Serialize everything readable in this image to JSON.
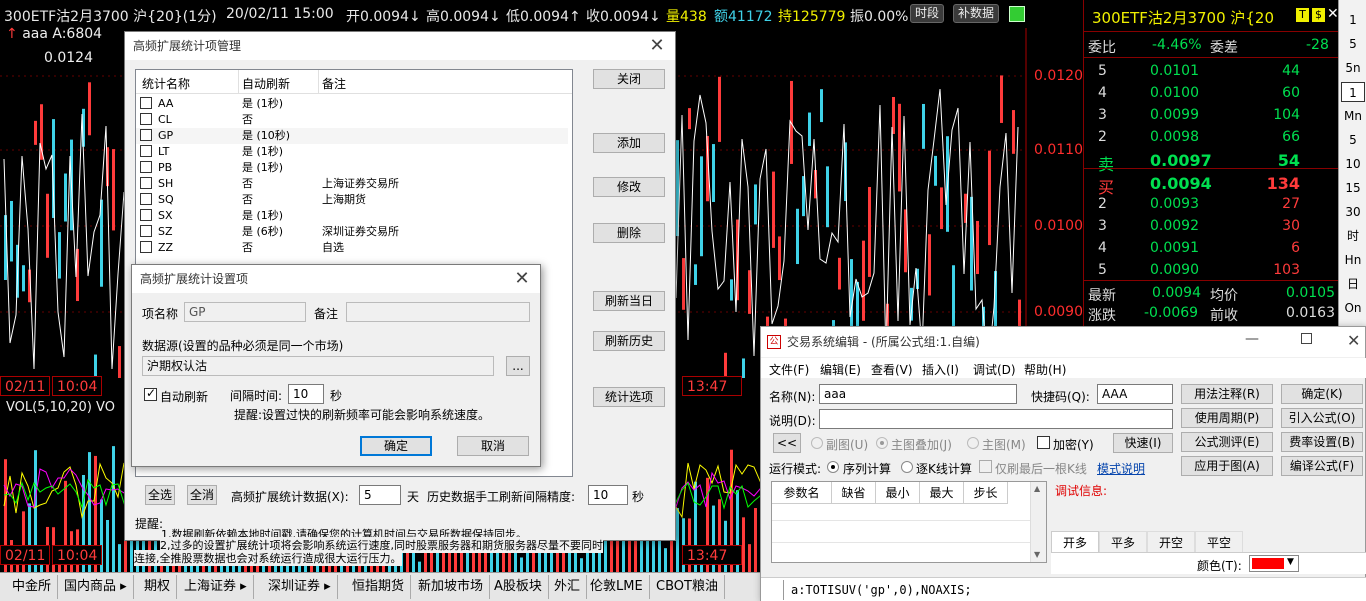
{
  "chart_header": {
    "title": "300ETF沽2月3700 沪{20}(1分)",
    "date_time": "20/02/11 15:00",
    "open": "开0.0094↓",
    "high": "高0.0094↓",
    "low": "低0.0094↑",
    "close": "收0.0094↓",
    "volume": "量438",
    "amount": "额41172",
    "hold": "持125779",
    "amplitude": "振0.00%",
    "btn_time_segment": "时段",
    "btn_fill_data": "补数据",
    "sub_title": "aaa  A:6804",
    "max_label": "0.0124"
  },
  "price_axis": [
    "0.0120",
    "0.0110",
    "0.0100",
    "0.0090"
  ],
  "date_boxes": {
    "top_left_a": "02/11",
    "top_left_b": "10:04",
    "top_right_a": "13:47",
    "bottom_left_a": "02/11",
    "bottom_left_b": "10:04",
    "bottom_right_a": "13:47"
  },
  "vol_label": "VOL(5,10,20) VO",
  "quote_panel": {
    "title": "300ETF沽2月3700 沪{20",
    "badge_t": "T",
    "badge_s": "$",
    "wei_bi_label": "委比",
    "wei_bi_value": "-4.46%",
    "wei_cha_label": "委差",
    "wei_cha_value": "-28",
    "sell": [
      {
        "level": "5",
        "price": "0.0101",
        "vol": "44"
      },
      {
        "level": "4",
        "price": "0.0100",
        "vol": "60"
      },
      {
        "level": "3",
        "price": "0.0099",
        "vol": "104"
      },
      {
        "level": "2",
        "price": "0.0098",
        "vol": "66"
      },
      {
        "level": "卖",
        "price": "0.0097",
        "vol": "54"
      }
    ],
    "buy": [
      {
        "level": "买",
        "price": "0.0094",
        "vol": "134"
      },
      {
        "level": "2",
        "price": "0.0093",
        "vol": "27"
      },
      {
        "level": "3",
        "price": "0.0092",
        "vol": "30"
      },
      {
        "level": "4",
        "price": "0.0091",
        "vol": "6"
      },
      {
        "level": "5",
        "price": "0.0090",
        "vol": "103"
      }
    ],
    "latest_label": "最新",
    "latest_value": "0.0094",
    "avg_label": "均价",
    "avg_value": "0.0105",
    "change_label": "涨跌",
    "change_value": "-0.0069",
    "prev_label": "前收",
    "prev_value": "0.0163"
  },
  "side_toolbar": [
    "1",
    "5",
    "5n",
    "1",
    "Mn",
    "5",
    "10",
    "15",
    "30",
    "时",
    "Hn",
    "日",
    "On"
  ],
  "bottom_tabs": [
    "中金所",
    "国内商品 ▸",
    "期权",
    "上海证券 ▸",
    "深圳证券 ▸",
    "恒指期货",
    "新加坡市场",
    "A股板块",
    "外汇",
    "伦敦LME",
    "CBOT粮油"
  ],
  "stats_dialog": {
    "title": "高频扩展统计项管理",
    "col_name": "统计名称",
    "col_auto": "自动刷新",
    "col_note": "备注",
    "rows": [
      {
        "name": "AA",
        "auto": "是 (1秒)",
        "note": ""
      },
      {
        "name": "CL",
        "auto": "否",
        "note": ""
      },
      {
        "name": "GP",
        "auto": "是 (10秒)",
        "note": ""
      },
      {
        "name": "LT",
        "auto": "是 (1秒)",
        "note": ""
      },
      {
        "name": "PB",
        "auto": "是 (1秒)",
        "note": ""
      },
      {
        "name": "SH",
        "auto": "否",
        "note": "上海证券交易所"
      },
      {
        "name": "SQ",
        "auto": "否",
        "note": "上海期货"
      },
      {
        "name": "SX",
        "auto": "是 (1秒)",
        "note": ""
      },
      {
        "name": "SZ",
        "auto": "是 (6秒)",
        "note": "深圳证券交易所"
      },
      {
        "name": "ZZ",
        "auto": "否",
        "note": "自选"
      }
    ],
    "btn_close": "关闭",
    "btn_add": "添加",
    "btn_modify": "修改",
    "btn_delete": "删除",
    "btn_refresh_today": "刷新当日",
    "btn_refresh_history": "刷新历史",
    "btn_stat_options": "统计选项",
    "btn_select_all": "全选",
    "btn_cancel_all": "全消",
    "days_label": "高频扩展统计数据(X):",
    "days_value": "5",
    "days_unit": "天",
    "precision_label": "历史数据手工刷新间隔精度:",
    "precision_value": "10",
    "precision_unit": "秒",
    "note_title": "提醒:",
    "note_line1": "1,数据刷新依赖本地时间戳,请确保您的计算机时间与交易所数据保持同步。",
    "note_line2": "2,过多的设置扩展统计项将会影响系统运行速度,同时股票服务器和期货服务器尽量不要同时",
    "note_line3": "连接,全推股票数据也会对系统运行造成很大运行压力。"
  },
  "settings_dialog": {
    "title": "高频扩展统计设置项",
    "name_label": "项名称",
    "name_value": "GP",
    "note_label": "备注",
    "note_value": "",
    "source_label": "数据源(设置的品种必须是同一个市场)",
    "source_value": "沪期权认沽",
    "browse_label": "...",
    "auto_refresh_label": "自动刷新",
    "interval_label": "间隔时间:",
    "interval_value": "10",
    "interval_unit": "秒",
    "hint": "提醒:设置过快的刷新频率可能会影响系统速度。",
    "btn_ok": "确定",
    "btn_cancel": "取消"
  },
  "formula_editor": {
    "title": "交易系统编辑 - (所属公式组:1.自编)",
    "menu": [
      "文件(F)",
      "编辑(E)",
      "查看(V)",
      "插入(I)",
      "调试(D)",
      "帮助(H)"
    ],
    "name_label": "名称(N):",
    "name_value": "aaa",
    "shortcut_label": "快捷码(Q):",
    "shortcut_value": "AAA",
    "desc_label": "说明(D):",
    "desc_value": "",
    "btn_usage_note": "用法注释(R)",
    "btn_ok": "确定(K)",
    "btn_period": "使用周期(P)",
    "btn_import": "引入公式(O)",
    "btn_test": "公式测评(E)",
    "btn_fee": "费率设置(B)",
    "btn_apply": "应用于图(A)",
    "btn_compile": "编译公式(F)",
    "btn_collapse": "<<",
    "radio_sub_chart": "副图(U)",
    "radio_main_overlay": "主图叠加(J)",
    "radio_main_chart": "主图(M)",
    "encrypt_label": "加密(Y)",
    "btn_fast": "快速(I)",
    "run_mode_label": "运行模式:",
    "radio_sequence": "序列计算",
    "radio_kline": "逐K线计算",
    "only_last_label": "仅刷最后一根K线",
    "mode_help": "模式说明",
    "debug_label": "调试信息:",
    "params_headers": [
      "参数名",
      "缺省",
      "最小",
      "最大",
      "步长"
    ],
    "tabs": [
      "开多",
      "平多",
      "开空",
      "平空"
    ],
    "color_label": "颜色(T):",
    "color_value": "#ff0000",
    "code": "a:TOTISUV('gp',0),NOAXIS;"
  }
}
